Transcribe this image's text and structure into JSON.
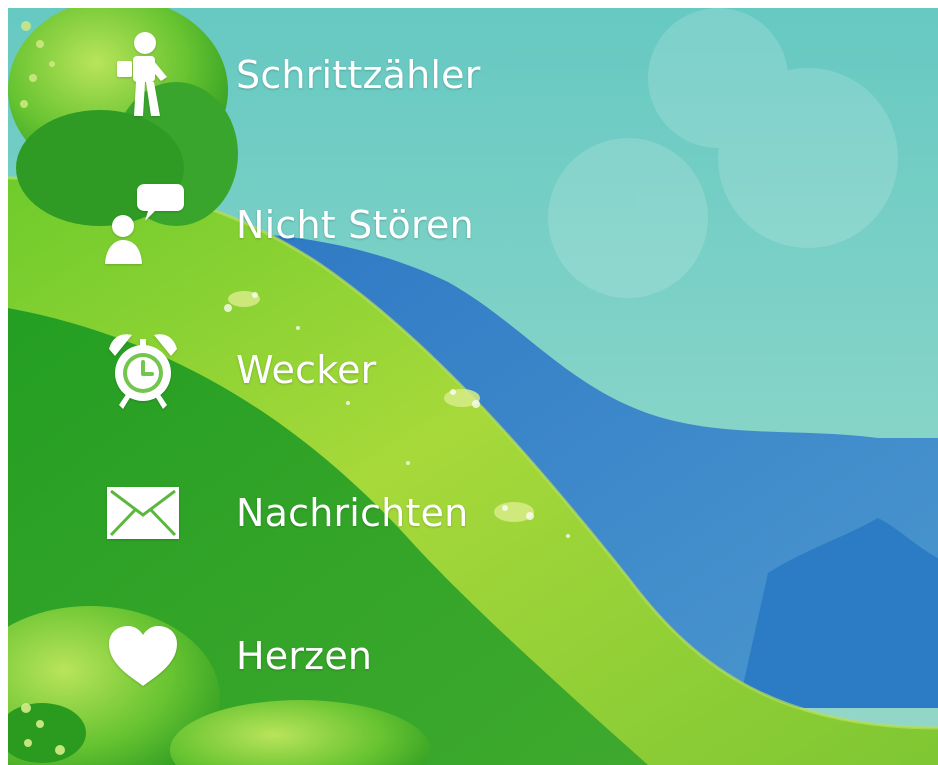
{
  "menu": {
    "items": [
      {
        "id": "pedometer",
        "label": "Schrittzähler",
        "icon": "pedometer-icon"
      },
      {
        "id": "do-not-disturb",
        "label": "Nicht Stören",
        "icon": "person-speech-bubble-icon"
      },
      {
        "id": "alarm",
        "label": "Wecker",
        "icon": "alarm-clock-icon"
      },
      {
        "id": "messages",
        "label": "Nachrichten",
        "icon": "envelope-icon"
      },
      {
        "id": "hearts",
        "label": "Herzen",
        "icon": "heart-icon"
      }
    ]
  },
  "colors": {
    "sky": "#73CDC3",
    "mountain": "#3E86C6",
    "hill_light": "#9ED43A",
    "hill_dark": "#2FA426",
    "label": "#FFFFFF"
  }
}
